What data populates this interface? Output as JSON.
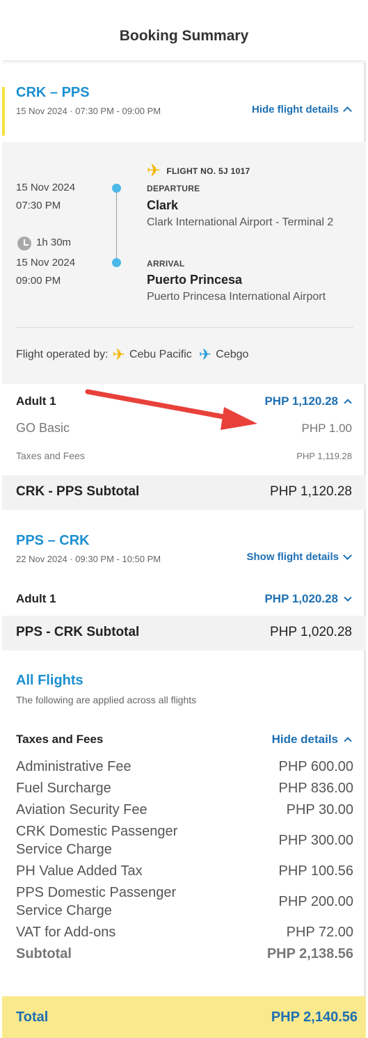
{
  "header": {
    "title": "Booking Summary"
  },
  "outbound": {
    "route": "CRK – PPS",
    "schedule": "15 Nov 2024 · 07:30 PM - 09:00 PM",
    "toggle_label": "Hide flight details",
    "flight_no": "FLIGHT NO. 5J 1017",
    "departure": {
      "date": "15 Nov 2024",
      "time": "07:30 PM",
      "label": "DEPARTURE",
      "city": "Clark",
      "airport": "Clark International Airport - Terminal 2"
    },
    "duration": "1h 30m",
    "arrival": {
      "date": "15 Nov 2024",
      "time": "09:00 PM",
      "label": "ARRIVAL",
      "city": "Puerto Princesa",
      "airport": "Puerto Princesa International Airport"
    },
    "operated_by_label": "Flight operated by:",
    "operators": [
      "Cebu Pacific",
      "Cebgo"
    ],
    "passenger_label": "Adult 1",
    "passenger_price": "PHP 1,120.28",
    "fare_name": "GO Basic",
    "fare_price": "PHP 1.00",
    "taxes_label": "Taxes and Fees",
    "taxes_price": "PHP 1,119.28",
    "subtotal_label": "CRK - PPS Subtotal",
    "subtotal_value": "PHP 1,120.28"
  },
  "return": {
    "route": "PPS – CRK",
    "schedule": "22 Nov 2024 · 09:30 PM - 10:50 PM",
    "toggle_label": "Show flight details",
    "passenger_label": "Adult 1",
    "passenger_price": "PHP 1,020.28",
    "subtotal_label": "PPS - CRK Subtotal",
    "subtotal_value": "PHP 1,020.28"
  },
  "all_flights": {
    "title": "All Flights",
    "subtitle": "The following are applied across all flights",
    "taxes_heading": "Taxes and Fees",
    "toggle_label": "Hide details",
    "fees": [
      {
        "label": "Administrative Fee",
        "value": "PHP 600.00"
      },
      {
        "label": "Fuel Surcharge",
        "value": "PHP 836.00"
      },
      {
        "label": "Aviation Security Fee",
        "value": "PHP 30.00"
      },
      {
        "label": "CRK Domestic Passenger Service Charge",
        "value": "PHP 300.00"
      },
      {
        "label": "PH Value Added Tax",
        "value": "PHP 100.56"
      },
      {
        "label": "PPS Domestic Passenger Service Charge",
        "value": "PHP 200.00"
      },
      {
        "label": "VAT for Add-ons",
        "value": "PHP 72.00"
      }
    ],
    "subtotal_label": "Subtotal",
    "subtotal_value": "PHP 2,138.56"
  },
  "total": {
    "label": "Total",
    "value": "PHP 2,140.56"
  },
  "colors": {
    "accent_blue": "#1b8fd1",
    "link_blue": "#1d6fb3",
    "total_bg": "#fbe98d",
    "plane_yellow": "#f4b400",
    "annotation_red": "#e8413a"
  }
}
